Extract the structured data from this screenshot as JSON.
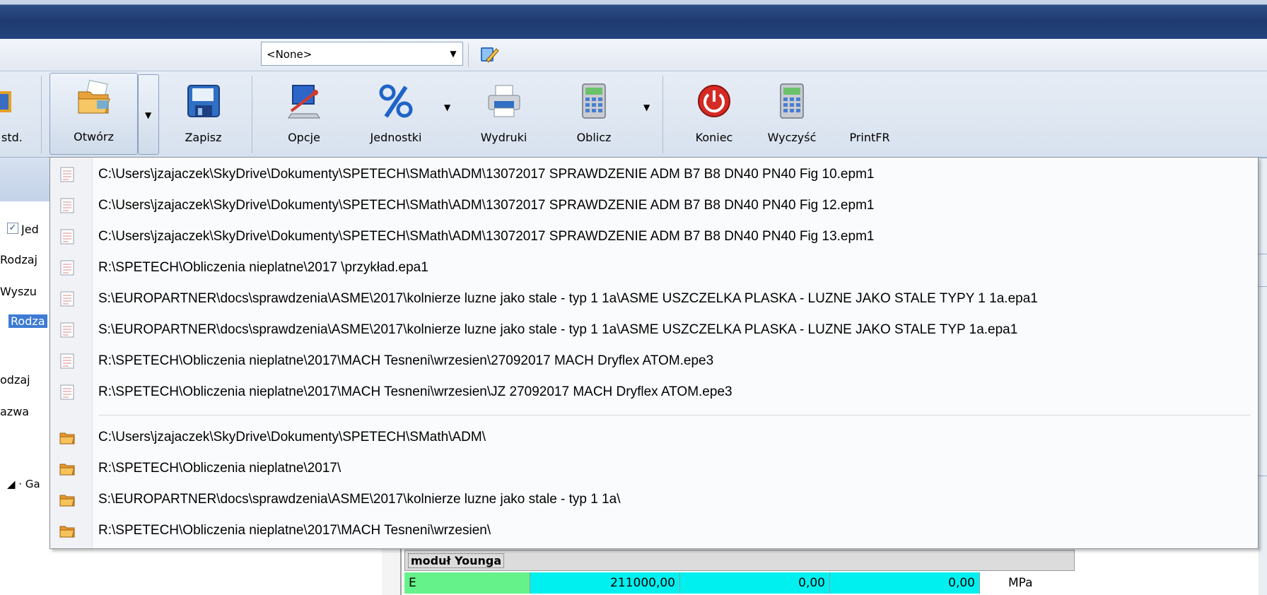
{
  "combo": {
    "value": "<None>"
  },
  "toolbar": {
    "std_label": "std.",
    "open_label": "Otwórz",
    "save_label": "Zapisz",
    "options_label": "Opcje",
    "units_label": "Jednostki",
    "print_label": "Wydruki",
    "calc_label": "Oblicz",
    "exit_label": "Koniec",
    "clear_label": "Wyczyść",
    "printfr_label": "PrintFR"
  },
  "leftpane": {
    "check_label": "Jed",
    "rodzaj": "Rodzaj",
    "wyszu": "Wyszu",
    "selected": "Rodza",
    "odzaj": "odzaj",
    "nazwa": "azwa",
    "tree": "◢ · Ga"
  },
  "recent_files": [
    "C:\\Users\\jzajaczek\\SkyDrive\\Dokumenty\\SPETECH\\SMath\\ADM\\13072017 SPRAWDZENIE ADM B7 B8 DN40 PN40 Fig 10.epm1",
    "C:\\Users\\jzajaczek\\SkyDrive\\Dokumenty\\SPETECH\\SMath\\ADM\\13072017 SPRAWDZENIE ADM B7 B8 DN40 PN40 Fig 12.epm1",
    "C:\\Users\\jzajaczek\\SkyDrive\\Dokumenty\\SPETECH\\SMath\\ADM\\13072017 SPRAWDZENIE ADM B7 B8 DN40 PN40 Fig 13.epm1",
    "R:\\SPETECH\\Obliczenia nieplatne\\2017  \\przykład.epa1",
    "S:\\EUROPARTNER\\docs\\sprawdzenia\\ASME\\2017\\kolnierze luzne jako stale - typ 1 1a\\ASME USZCZELKA PLASKA - LUZNE JAKO STALE TYPY 1 1a.epa1",
    "S:\\EUROPARTNER\\docs\\sprawdzenia\\ASME\\2017\\kolnierze luzne jako stale - typ 1 1a\\ASME USZCZELKA PLASKA - LUZNE JAKO STALE TYP 1a.epa1",
    "R:\\SPETECH\\Obliczenia nieplatne\\2017\\MACH Tesneni\\wrzesien\\27092017 MACH Dryflex ATOM.epe3",
    "R:\\SPETECH\\Obliczenia nieplatne\\2017\\MACH Tesneni\\wrzesien\\JZ 27092017 MACH Dryflex ATOM.epe3"
  ],
  "recent_folders": [
    "C:\\Users\\jzajaczek\\SkyDrive\\Dokumenty\\SPETECH\\SMath\\ADM\\",
    "R:\\SPETECH\\Obliczenia nieplatne\\2017\\",
    "S:\\EUROPARTNER\\docs\\sprawdzenia\\ASME\\2017\\kolnierze luzne jako stale - typ 1 1a\\",
    "R:\\SPETECH\\Obliczenia nieplatne\\2017\\MACH Tesneni\\wrzesien\\"
  ],
  "grid": {
    "section": "moduł Younga",
    "row": {
      "name": "E",
      "v1": "211000,00",
      "v2": "0,00",
      "v3": "0,00",
      "unit": "MPa"
    }
  }
}
